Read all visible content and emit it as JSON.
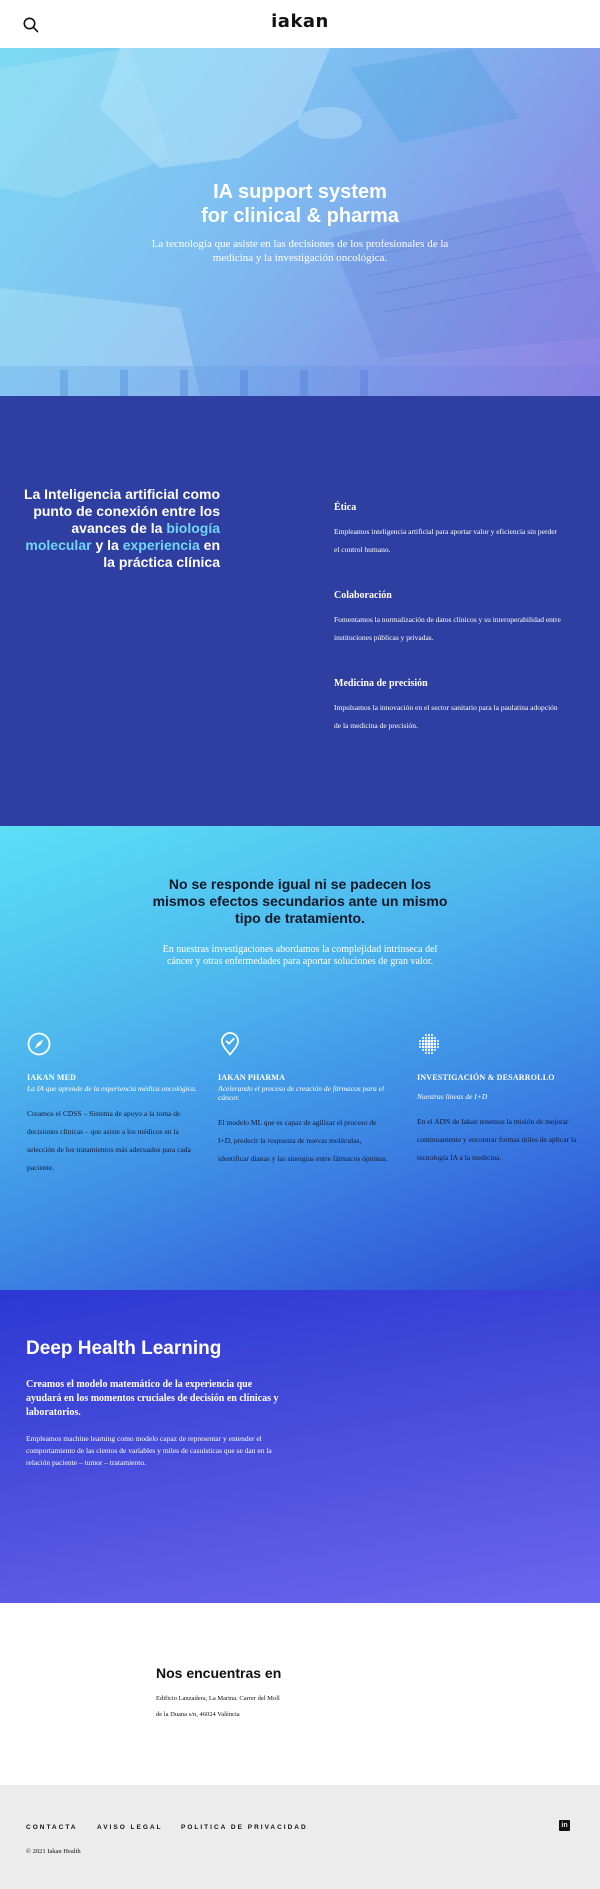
{
  "header": {
    "logo": "iakan"
  },
  "hero": {
    "title_line1": "IA support system",
    "title_line2": "for clinical & pharma",
    "subtitle": "La tecnología que asiste en las decisiones de los profesionales de la medicina y la investigación oncológica."
  },
  "values": {
    "headline": {
      "part1": "La Inteligencia artificial como punto de conexión entre los avances de la ",
      "highlight1": "biología molecular",
      "part2": " y la ",
      "highlight2": "experiencia",
      "part3": " en la práctica clínica"
    },
    "items": [
      {
        "title": "Ética",
        "text": "Empleamos inteligencia artificial para aportar valor y eficiencia sin perder el control humano."
      },
      {
        "title": "Colaboración",
        "text": "Fomentamos la normalización de datos clínicos y su interoperabilidad entre instituciones públicas y privadas."
      },
      {
        "title": "Medicina de precisión",
        "text": "Impulsamos la innovación en el sector sanitario para la paulatina adopción de la medicina de precisión."
      }
    ]
  },
  "research": {
    "title": "No se responde igual ni se padecen los mismos efectos secundarios ante un mismo tipo de tratamiento.",
    "subtitle": "En nuestras investigaciones abordamos la complejidad intrínseca del cáncer y otras enfermedades para aportar soluciones de gran valor.",
    "columns": [
      {
        "icon": "compass-icon",
        "title": "IAKAN MED",
        "tagline": "La IA que aprende de la experiencia médica oncológica.",
        "text": "Creamos el CDSS – Sistema de apoyo a la toma de decisiones clínicas – que asiste a los médicos en la selección de los tratamientos más adecuados para cada paciente."
      },
      {
        "icon": "location-check-icon",
        "title": "IAKAN PHARMA",
        "tagline": "Acelerando el proceso de creación de fármacos para el cáncer.",
        "text": "El modelo ML que es capaz de agilizar el proceso de I+D, predecir la respuesta de nuevas moléculas, identificar dianas y las sinergias entre fármacos óptimas."
      },
      {
        "icon": "dots-sphere-icon",
        "title": "INVESTIGACIÓN & DESARROLLO",
        "tagline": "Nuestras líneas de I+D",
        "text": "En el ADN de Iakan tenemos la misión de mejorar continuamente y encontrar formas útiles de aplicar la tecnología IA a la medicina."
      }
    ]
  },
  "dhl": {
    "title": "Deep Health Learning",
    "subtitle": "Creamos el modelo matemático de la experiencia que ayudará en los momentos cruciales de decisión en clínicas y laboratorios.",
    "text": "Empleamos machine learning como modelo capaz de representar y entender el comportamiento de las cientos de variables y miles de casuísticas que se dan en la relación paciente – tumor – tratamiento."
  },
  "location": {
    "title": "Nos encuentras en",
    "line1": "Edificio Lanzadera, La Marina. Carrer del Moll",
    "line2": "de la Duana s/n, 46024 València"
  },
  "footer": {
    "links": [
      "CONTACTA",
      "AVISO LEGAL",
      "POLITICA DE PRIVACIDAD"
    ],
    "social": "in",
    "copyright": "© 2021  Iakan Health"
  }
}
